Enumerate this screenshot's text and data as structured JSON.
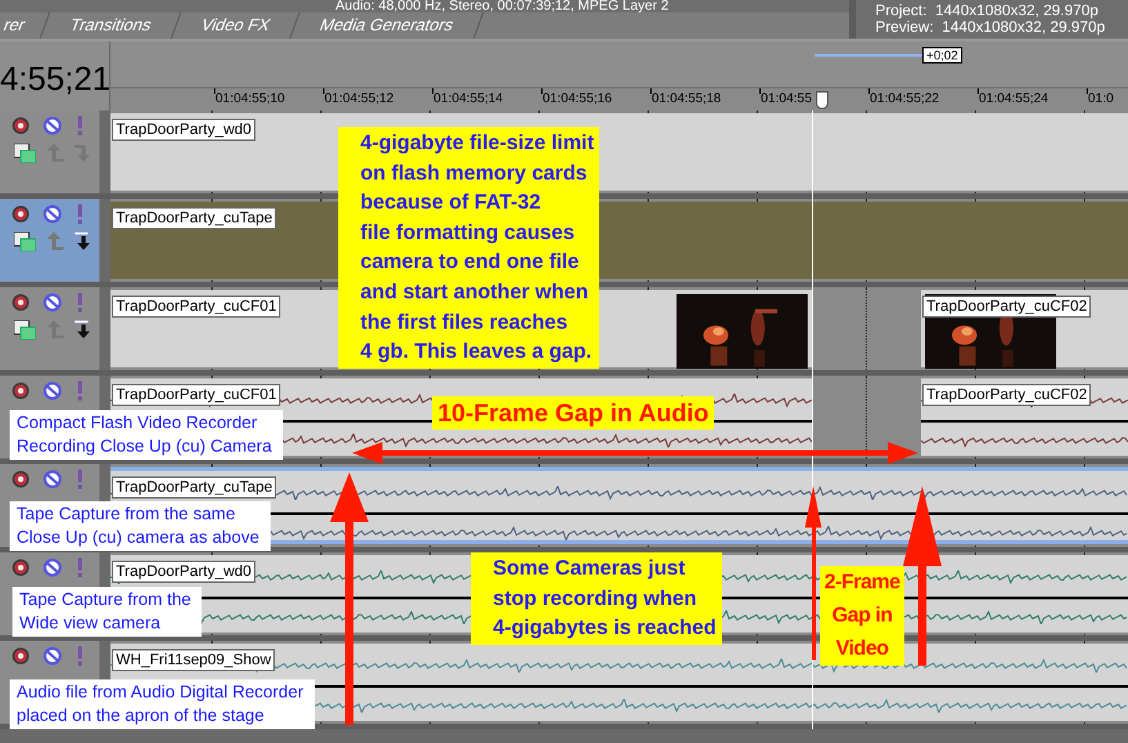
{
  "top_panel": {
    "media_info": "Audio: 48,000 Hz, Stereo, 00:07:39;12, MPEG Layer 2",
    "tabs": [
      {
        "label": "rer",
        "selected": false
      },
      {
        "label": "Transitions",
        "selected": false
      },
      {
        "label": "Video FX",
        "selected": false
      },
      {
        "label": "Media Generators",
        "selected": false
      }
    ],
    "project": "Project:  1440x1080x32, 29.970p",
    "preview": "Preview:  1440x1080x32, 29.970p"
  },
  "timecode": "4:55;21",
  "selection_length": "+0;02",
  "ruler": [
    "01:04:55;10",
    "01:04:55;12",
    "01:04:55;14",
    "01:04:55;16",
    "01:04:55;18",
    "01:04:55",
    "01:04:55;22",
    "01:04:55;24",
    "01:0"
  ],
  "tracks": [
    {
      "kind": "video",
      "selected": false,
      "child": false,
      "clips": [
        {
          "label": "TrapDoorParty_wd0",
          "kind": "full",
          "selected": false,
          "thumbnail": false
        }
      ]
    },
    {
      "kind": "video",
      "selected": true,
      "child": true,
      "clips": [
        {
          "label": "TrapDoorParty_cuTape",
          "kind": "full",
          "selected": true,
          "thumbnail": false
        }
      ]
    },
    {
      "kind": "video",
      "selected": false,
      "child": true,
      "clips": [
        {
          "label": "TrapDoorParty_cuCF01",
          "kind": "before_gap",
          "selected": false,
          "thumbnail": true
        },
        {
          "label": "TrapDoorParty_cuCF02",
          "kind": "after_gap",
          "selected": false,
          "thumbnail": true
        }
      ]
    },
    {
      "kind": "audio",
      "selected": false,
      "color": "#7a3a3a",
      "clips": [
        {
          "label": "TrapDoorParty_cuCF01",
          "kind": "before_gap",
          "selected": false
        },
        {
          "label": "TrapDoorParty_cuCF02",
          "kind": "after_gap",
          "selected": false
        }
      ]
    },
    {
      "kind": "audio",
      "selected": false,
      "color": "#4d6282",
      "clips": [
        {
          "label": "TrapDoorParty_cuTape",
          "kind": "full",
          "selected": true
        }
      ]
    },
    {
      "kind": "audio",
      "selected": false,
      "color": "#2f7d6c",
      "clips": [
        {
          "label": "TrapDoorParty_wd0",
          "kind": "full",
          "selected": false
        }
      ]
    },
    {
      "kind": "audio",
      "selected": false,
      "color": "#4a8c96",
      "clips": [
        {
          "label": "WH_Fri11sep09_Show",
          "kind": "full",
          "selected": false
        }
      ]
    }
  ],
  "annotations": [
    {
      "kind": "note",
      "text": "4-gigabyte file-size limit\non flash memory cards\nbecause of FAT-32\nfile formatting causes\ncamera to end one file\nand start another when\nthe first files reaches\n4 gb. This leaves a gap."
    },
    {
      "kind": "headline",
      "text": "10-Frame Gap in Audio"
    },
    {
      "kind": "label",
      "text": "Compact Flash Video Recorder\nRecording Close Up (cu) Camera"
    },
    {
      "kind": "label",
      "text": "Tape Capture from the same\nClose Up (cu) camera as above"
    },
    {
      "kind": "label",
      "text": "Tape Capture from the\nWide view camera"
    },
    {
      "kind": "label",
      "text": "Audio file from Audio Digital Recorder\nplaced on the apron of the stage"
    },
    {
      "kind": "note",
      "text": "Some Cameras just\nstop recording when\n4-gigabytes is reached"
    },
    {
      "kind": "headline_narrow",
      "text": "2-Frame\nGap in\nVideo"
    }
  ]
}
